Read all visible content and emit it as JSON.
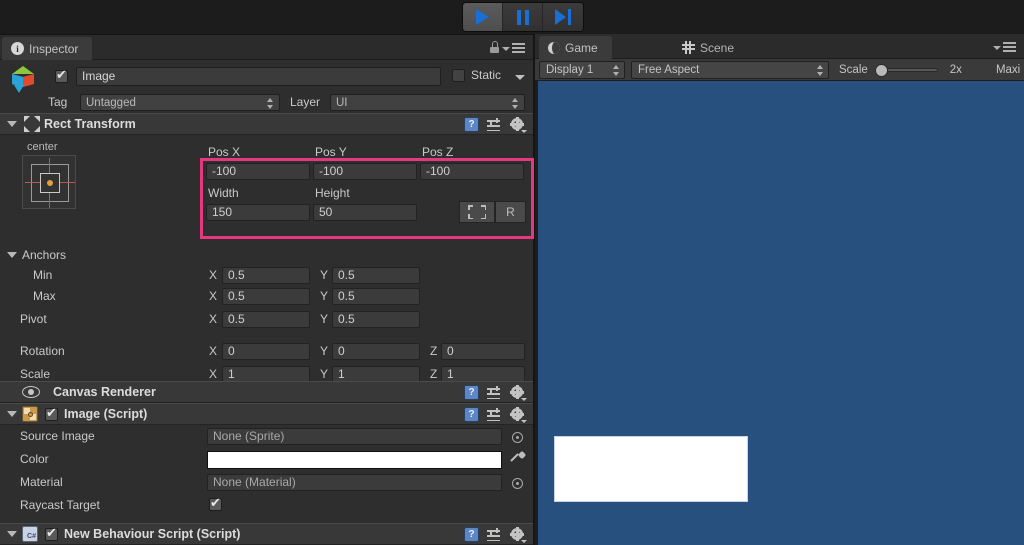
{
  "toolbar": {
    "play_label": "Play",
    "pause_label": "Pause",
    "step_label": "Step",
    "play_active": true
  },
  "inspector": {
    "tab_label": "Inspector",
    "tab_icon": "info-icon",
    "lock_icon": "lock-icon",
    "menu_icon": "burger-menu-icon",
    "object": {
      "enabled": true,
      "name": "Image",
      "static_label": "Static",
      "static_checked": false,
      "tag_label": "Tag",
      "tag_value": "Untagged",
      "layer_label": "Layer",
      "layer_value": "UI"
    },
    "rect_transform": {
      "title": "Rect Transform",
      "anchor_preset_h": "center",
      "anchor_preset_v": "middle",
      "fields": {
        "pos_x_label": "Pos X",
        "pos_x": "-100",
        "pos_y_label": "Pos Y",
        "pos_y": "-100",
        "pos_z_label": "Pos Z",
        "pos_z": "-100",
        "width_label": "Width",
        "width": "150",
        "height_label": "Height",
        "height": "50"
      },
      "blueprint_label": "",
      "raw_label": "R",
      "highlighted": true,
      "highlight_color": "#e5387f"
    },
    "anchors": {
      "title": "Anchors",
      "min_label": "Min",
      "min_x": "0.5",
      "min_y": "0.5",
      "max_label": "Max",
      "max_x": "0.5",
      "max_y": "0.5",
      "pivot_label": "Pivot",
      "pivot_x": "0.5",
      "pivot_y": "0.5",
      "rotation_label": "Rotation",
      "rot_x": "0",
      "rot_y": "0",
      "rot_z": "0",
      "scale_label": "Scale",
      "scale_x": "1",
      "scale_y": "1",
      "scale_z": "1",
      "axis_x": "X",
      "axis_y": "Y",
      "axis_z": "Z"
    },
    "canvas_renderer": {
      "title": "Canvas Renderer"
    },
    "image_script": {
      "title": "Image (Script)",
      "enabled": true,
      "source_image_label": "Source Image",
      "source_image_value": "None (Sprite)",
      "color_label": "Color",
      "color_value": "#ffffff",
      "material_label": "Material",
      "material_value": "None (Material)",
      "raycast_label": "Raycast Target",
      "raycast_checked": true
    },
    "behaviour_script": {
      "title": "New Behaviour Script (Script)",
      "enabled": true
    }
  },
  "game": {
    "tabs": [
      {
        "label": "Game",
        "icon": "game-moon-icon",
        "selected": true
      },
      {
        "label": "Scene",
        "icon": "scene-grid-icon",
        "selected": false
      }
    ],
    "menu_icon": "burger-menu-icon",
    "display_value": "Display 1",
    "aspect_value": "Free Aspect",
    "scale_label": "Scale",
    "scale_value": "2x",
    "maximize_label": "Maxi",
    "background_color": "#27507e",
    "image_color": "#ffffff"
  }
}
